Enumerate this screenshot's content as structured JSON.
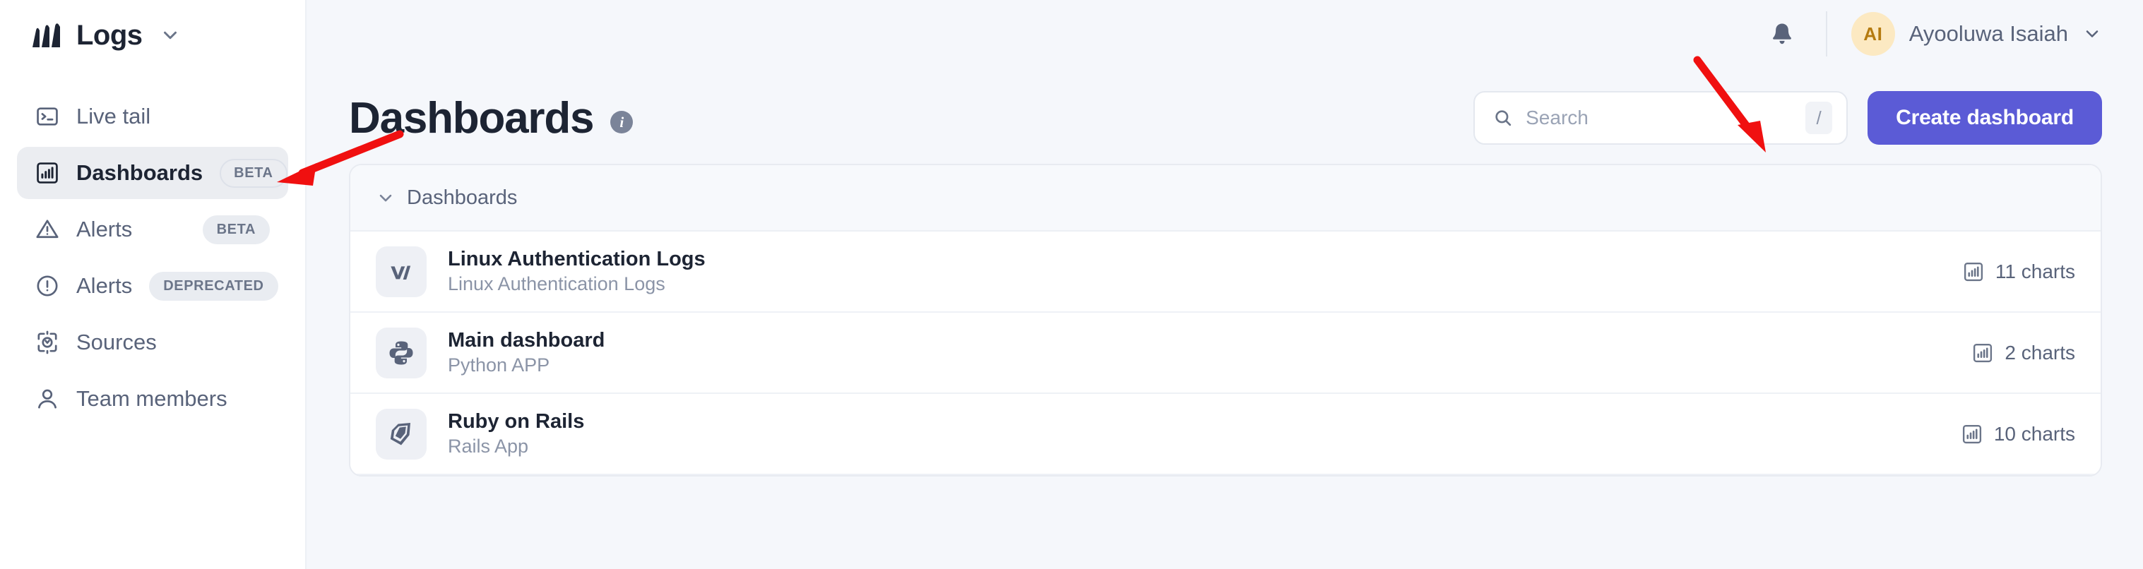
{
  "sidebar": {
    "brand": {
      "name": "Logs",
      "logo_icon": "better-stack-logo",
      "chevron_icon": "chevron-down-icon"
    },
    "items": [
      {
        "label": "Live tail",
        "icon": "terminal-icon",
        "badge": "",
        "active": false
      },
      {
        "label": "Dashboards",
        "icon": "bar-chart-icon",
        "badge": "BETA",
        "active": true
      },
      {
        "label": "Alerts",
        "icon": "warning-triangle-icon",
        "badge": "BETA",
        "active": false
      },
      {
        "label": "Alerts",
        "icon": "alert-circle-icon",
        "badge": "DEPRECATED",
        "active": false
      },
      {
        "label": "Sources",
        "icon": "sources-icon",
        "badge": "",
        "active": false
      },
      {
        "label": "Team members",
        "icon": "user-icon",
        "badge": "",
        "active": false
      }
    ]
  },
  "topbar": {
    "bell_icon": "bell-icon",
    "user": {
      "initials": "AI",
      "name": "Ayooluwa Isaiah",
      "chevron_icon": "chevron-down-icon"
    }
  },
  "page": {
    "title": "Dashboards",
    "info_icon": "info-icon",
    "info_glyph": "i"
  },
  "search": {
    "placeholder": "Search",
    "value": "",
    "icon": "search-icon",
    "shortcut": "/"
  },
  "actions": {
    "create_label": "Create dashboard"
  },
  "list": {
    "group_title": "Dashboards",
    "group_chevron_icon": "chevron-down-icon",
    "rows": [
      {
        "title": "Linux Authentication Logs",
        "subtitle": "Linux Authentication Logs",
        "icon": "vector-logo-icon",
        "charts": "11 charts",
        "charts_icon": "bar-chart-icon"
      },
      {
        "title": "Main dashboard",
        "subtitle": "Python APP",
        "icon": "python-logo-icon",
        "charts": "2 charts",
        "charts_icon": "bar-chart-icon"
      },
      {
        "title": "Ruby on Rails",
        "subtitle": "Rails App",
        "icon": "ruby-logo-icon",
        "charts": "10 charts",
        "charts_icon": "bar-chart-icon"
      }
    ]
  },
  "annotations": {
    "arrow_color": "#f01010",
    "arrows": [
      {
        "name": "arrow-to-dashboards-nav",
        "target": "Dashboards sidebar item"
      },
      {
        "name": "arrow-to-create-dashboard",
        "target": "Create dashboard button"
      }
    ]
  },
  "colors": {
    "accent": "#5b5bd6",
    "page_bg": "#f5f7fb",
    "sidebar_bg": "#ffffff",
    "text_primary": "#1d2433",
    "text_muted": "#59637a",
    "avatar_bg": "#fce9c2",
    "avatar_fg": "#b57b10"
  }
}
